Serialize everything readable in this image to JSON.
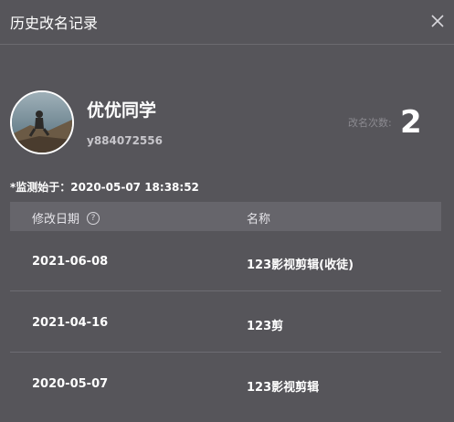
{
  "dialog": {
    "title": "历史改名记录",
    "close_icon": "close-icon"
  },
  "profile": {
    "name": "优优同学",
    "id": "y884072556",
    "rename_label": "改名次数:",
    "rename_count": "2"
  },
  "monitor_text": "*监测始于：2020-05-07 18:38:52",
  "table": {
    "headers": {
      "date": "修改日期",
      "name": "名称",
      "help_icon": "help-circle-icon"
    },
    "rows": [
      {
        "date": "2021-06-08",
        "name": "123影视剪辑(收徒)"
      },
      {
        "date": "2021-04-16",
        "name": "123剪"
      },
      {
        "date": "2020-05-07",
        "name": "123影视剪辑"
      }
    ]
  }
}
